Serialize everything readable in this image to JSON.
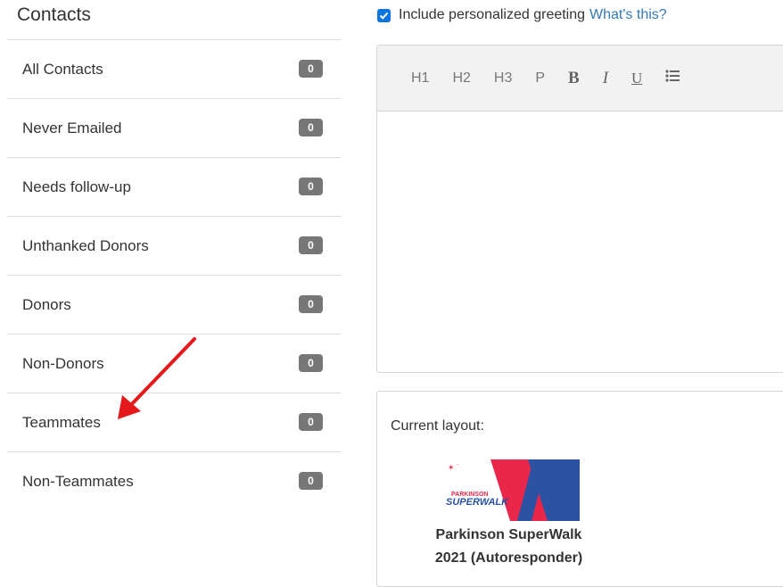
{
  "sidebar": {
    "title": "Contacts",
    "items": [
      {
        "label": "All Contacts",
        "count": "0"
      },
      {
        "label": "Never Emailed",
        "count": "0"
      },
      {
        "label": "Needs follow-up",
        "count": "0"
      },
      {
        "label": "Unthanked Donors",
        "count": "0"
      },
      {
        "label": "Donors",
        "count": "0"
      },
      {
        "label": "Non-Donors",
        "count": "0"
      },
      {
        "label": "Teammates",
        "count": "0"
      },
      {
        "label": "Non-Teammates",
        "count": "0"
      }
    ]
  },
  "greeting": {
    "checked": true,
    "label": "Include personalized greeting",
    "help_link": "What's this?"
  },
  "toolbar": {
    "h1": "H1",
    "h2": "H2",
    "h3": "H3",
    "p": "P",
    "bold": "B",
    "italic": "I",
    "underline": "U",
    "list_icon": "list-icon"
  },
  "layout": {
    "label": "Current layout:",
    "logo_text_top": "PARKINSON",
    "logo_text_bottom": "SUPERWALK",
    "caption_line1": "Parkinson SuperWalk",
    "caption_line2": "2021 (Autoresponder)"
  },
  "colors": {
    "badge": "#777777",
    "link": "#337ab7",
    "checkbox": "#0b74de",
    "annotation_arrow": "#e3191b"
  }
}
